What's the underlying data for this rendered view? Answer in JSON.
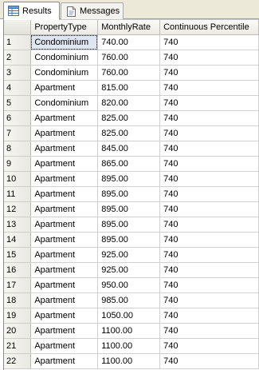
{
  "tabs": [
    {
      "label": "Results",
      "icon": "results-grid-icon",
      "active": true
    },
    {
      "label": "Messages",
      "icon": "messages-icon",
      "active": false
    }
  ],
  "columns": [
    "",
    "PropertyType",
    "MonthlyRate",
    "Continuous Percentile"
  ],
  "rows": [
    [
      "1",
      "Condominium",
      "740.00",
      "740"
    ],
    [
      "2",
      "Condominium",
      "760.00",
      "740"
    ],
    [
      "3",
      "Condominium",
      "760.00",
      "740"
    ],
    [
      "4",
      "Apartment",
      "815.00",
      "740"
    ],
    [
      "5",
      "Condominium",
      "820.00",
      "740"
    ],
    [
      "6",
      "Apartment",
      "825.00",
      "740"
    ],
    [
      "7",
      "Apartment",
      "825.00",
      "740"
    ],
    [
      "8",
      "Apartment",
      "845.00",
      "740"
    ],
    [
      "9",
      "Apartment",
      "865.00",
      "740"
    ],
    [
      "10",
      "Apartment",
      "895.00",
      "740"
    ],
    [
      "11",
      "Apartment",
      "895.00",
      "740"
    ],
    [
      "12",
      "Apartment",
      "895.00",
      "740"
    ],
    [
      "13",
      "Apartment",
      "895.00",
      "740"
    ],
    [
      "14",
      "Apartment",
      "895.00",
      "740"
    ],
    [
      "15",
      "Apartment",
      "925.00",
      "740"
    ],
    [
      "16",
      "Apartment",
      "925.00",
      "740"
    ],
    [
      "17",
      "Apartment",
      "950.00",
      "740"
    ],
    [
      "18",
      "Apartment",
      "985.00",
      "740"
    ],
    [
      "19",
      "Apartment",
      "1050.00",
      "740"
    ],
    [
      "20",
      "Apartment",
      "1100.00",
      "740"
    ],
    [
      "21",
      "Apartment",
      "1100.00",
      "740"
    ],
    [
      "22",
      "Apartment",
      "1100.00",
      "740"
    ]
  ],
  "selected_cell": {
    "row": 1,
    "column": "PropertyType"
  },
  "colors": {
    "tab_strip_bg": "#ece9d8",
    "header_bg": "#ebeae4",
    "grid_line": "#d0d0d0",
    "selection_bg": "#dfe6f1"
  }
}
